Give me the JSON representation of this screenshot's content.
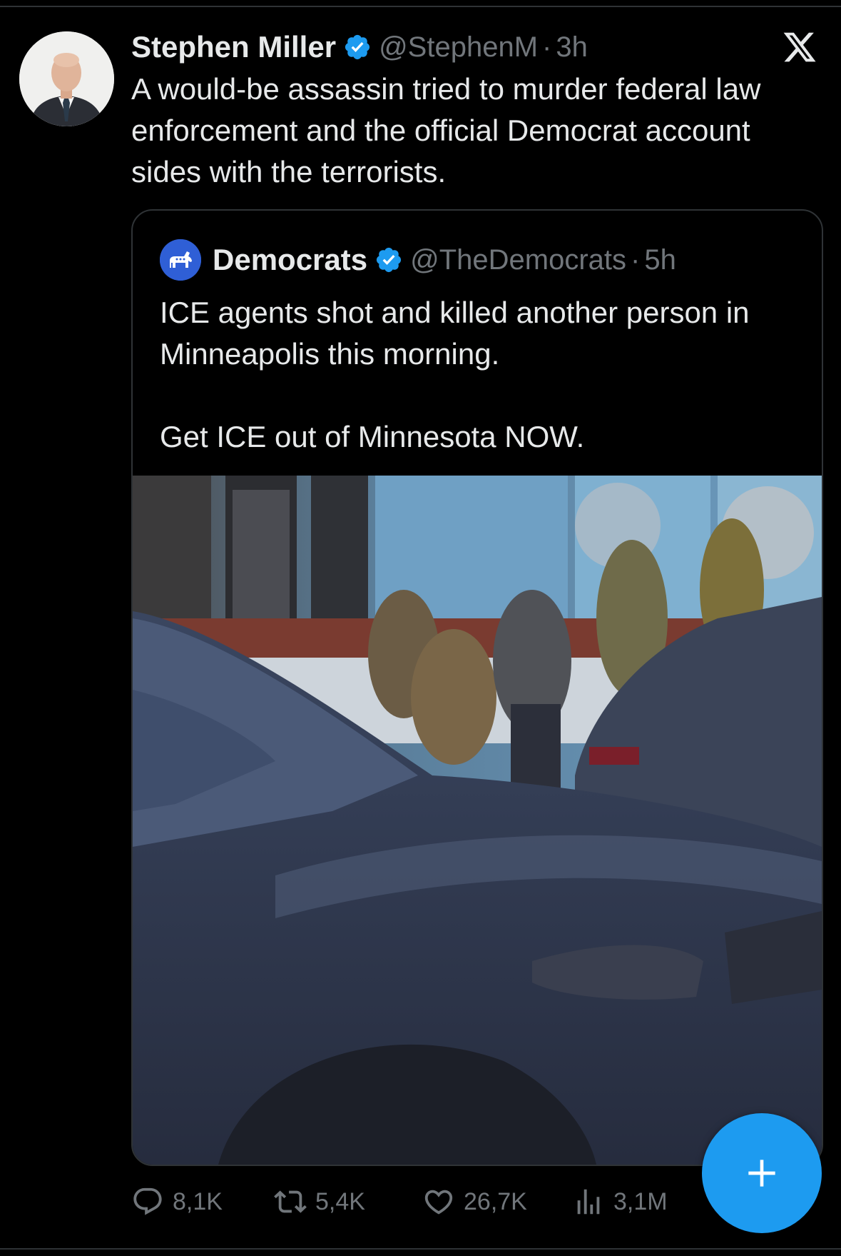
{
  "tweet": {
    "author_name": "Stephen Miller",
    "author_handle": "@StephenM",
    "separator": "·",
    "time": "3h",
    "text": "A would-be assassin tried to murder federal law enforcement and the official Democrat account sides with the terrorists."
  },
  "quote": {
    "author_name": "Democrats",
    "author_handle": "@TheDemocrats",
    "separator": "·",
    "time": "5h",
    "text_line1": "ICE agents shot and killed another person in Minneapolis this morning.",
    "text_line2": "Get ICE out of Minnesota NOW."
  },
  "actions": {
    "replies": "8,1K",
    "reposts": "5,4K",
    "likes": "26,7K",
    "views": "3,1M"
  },
  "icons": {
    "verified": "verified-badge-icon",
    "x_logo": "x-logo-icon",
    "reply": "reply-bubble-icon",
    "repost": "repost-arrows-icon",
    "like": "heart-icon",
    "views": "bar-chart-icon",
    "compose": "plus-icon"
  },
  "colors": {
    "background": "#000000",
    "text_primary": "#e7e9ea",
    "text_secondary": "#71767b",
    "accent": "#1d9bf0",
    "border": "#2f3336",
    "democrats_blue": "#2f5fd6"
  }
}
